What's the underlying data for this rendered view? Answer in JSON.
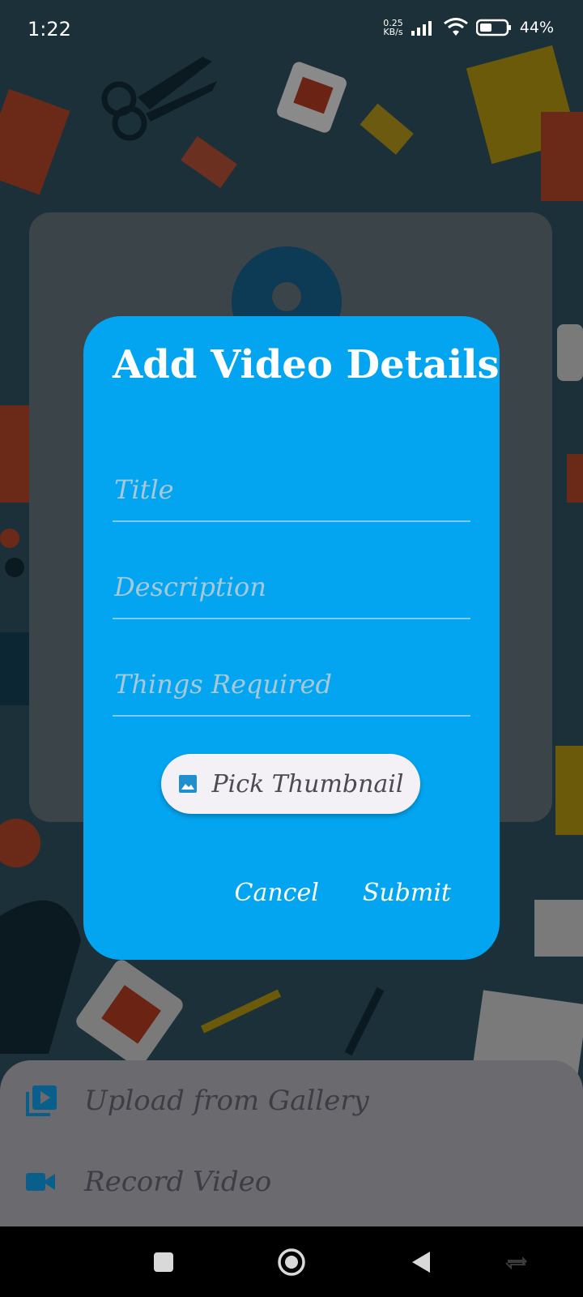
{
  "status_bar": {
    "time": "1:22",
    "net_speed_value": "0.25",
    "net_speed_unit": "KB/s",
    "battery": "44%"
  },
  "dialog": {
    "title": "Add Video Details",
    "fields": [
      {
        "placeholder": "Title",
        "value": ""
      },
      {
        "placeholder": "Description",
        "value": ""
      },
      {
        "placeholder": "Things Required",
        "value": ""
      }
    ],
    "thumbnail_button": {
      "label": "Pick Thumbnail",
      "icon": "image-icon"
    },
    "cancel_label": "Cancel",
    "submit_label": "Submit"
  },
  "bottom_sheet": {
    "items": [
      {
        "label": "Upload from Gallery",
        "icon": "video-library-icon"
      },
      {
        "label": "Record Video",
        "icon": "videocam-icon"
      }
    ]
  },
  "colors": {
    "dialog_bg": "#03a5f0",
    "accent": "#0a6ea4",
    "sheet_bg": "#6b6a6f"
  }
}
